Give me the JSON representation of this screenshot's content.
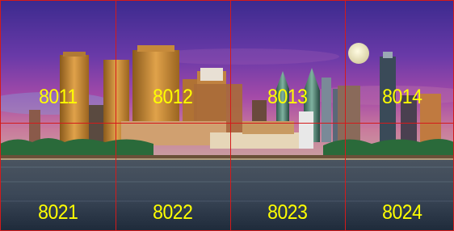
{
  "scene": {
    "description_icon": "philadelphia-skyline-photo"
  },
  "colors": {
    "label": "#ffff00",
    "grid_line": "#d41a1a"
  },
  "tiles": [
    {
      "id": "8011",
      "label": "8011"
    },
    {
      "id": "8012",
      "label": "8012"
    },
    {
      "id": "8013",
      "label": "8013"
    },
    {
      "id": "8014",
      "label": "8014"
    },
    {
      "id": "8021",
      "label": "8021"
    },
    {
      "id": "8022",
      "label": "8022"
    },
    {
      "id": "8023",
      "label": "8023"
    },
    {
      "id": "8024",
      "label": "8024"
    }
  ]
}
